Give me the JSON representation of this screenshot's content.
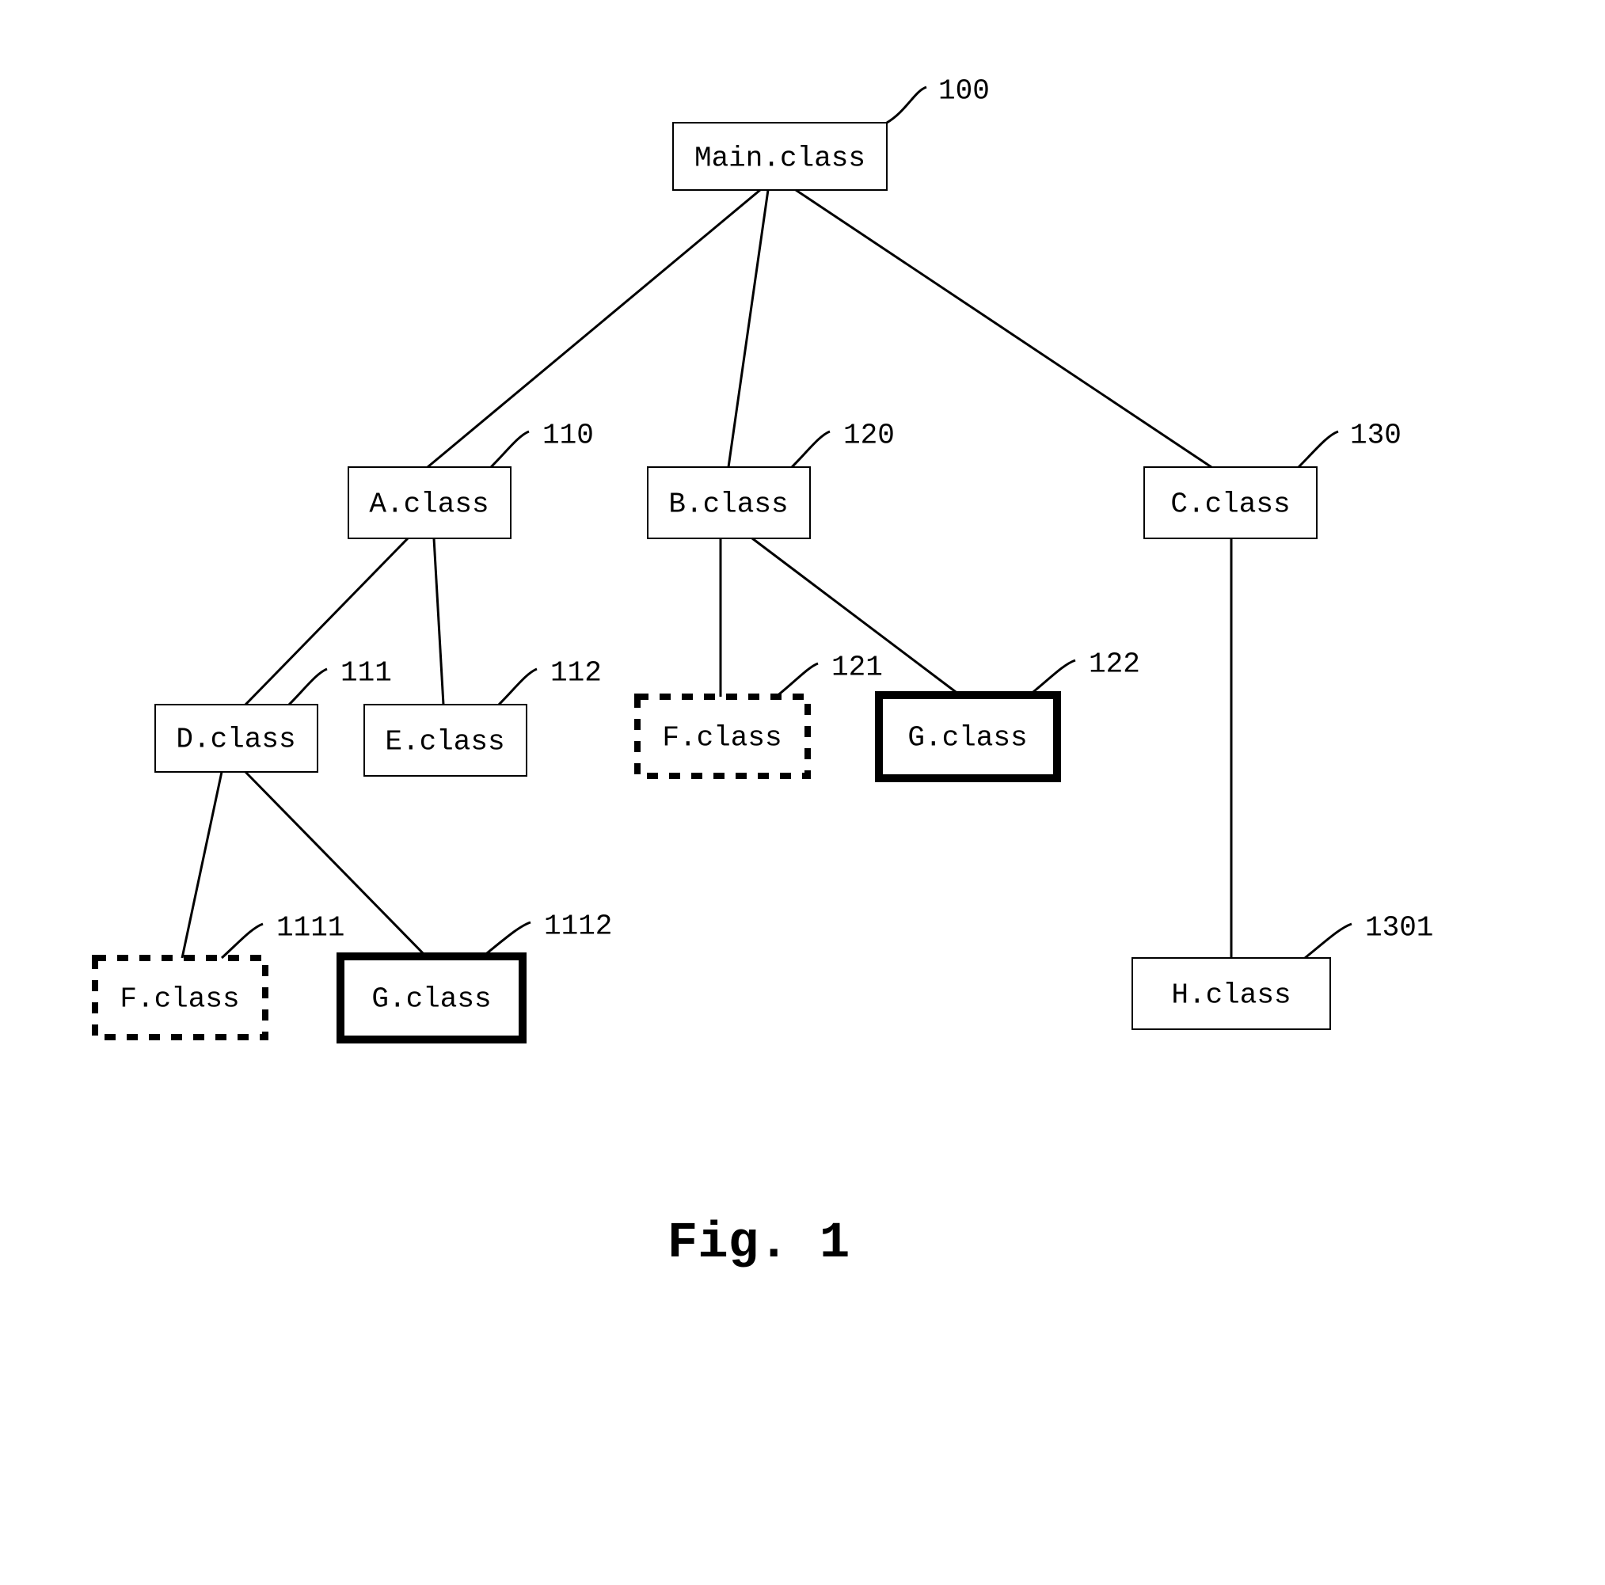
{
  "figure_label": "Fig. 1",
  "nodes": {
    "main": {
      "label": "Main.class",
      "ref": "100"
    },
    "a": {
      "label": "A.class",
      "ref": "110"
    },
    "b": {
      "label": "B.class",
      "ref": "120"
    },
    "c": {
      "label": "C.class",
      "ref": "130"
    },
    "d": {
      "label": "D.class",
      "ref": "111"
    },
    "e": {
      "label": "E.class",
      "ref": "112"
    },
    "f1": {
      "label": "F.class",
      "ref": "121"
    },
    "g1": {
      "label": "G.class",
      "ref": "122"
    },
    "f2": {
      "label": "F.class",
      "ref": "1111"
    },
    "g2": {
      "label": "G.class",
      "ref": "1112"
    },
    "h": {
      "label": "H.class",
      "ref": "1301"
    }
  },
  "chart_data": {
    "type": "tree",
    "title": "Fig. 1",
    "nodes": [
      {
        "id": "100",
        "label": "Main.class",
        "style": "thin"
      },
      {
        "id": "110",
        "label": "A.class",
        "style": "thin"
      },
      {
        "id": "120",
        "label": "B.class",
        "style": "thin"
      },
      {
        "id": "130",
        "label": "C.class",
        "style": "thin"
      },
      {
        "id": "111",
        "label": "D.class",
        "style": "thin"
      },
      {
        "id": "112",
        "label": "E.class",
        "style": "thin"
      },
      {
        "id": "121",
        "label": "F.class",
        "style": "dotted"
      },
      {
        "id": "122",
        "label": "G.class",
        "style": "thick"
      },
      {
        "id": "1111",
        "label": "F.class",
        "style": "dotted"
      },
      {
        "id": "1112",
        "label": "G.class",
        "style": "thick"
      },
      {
        "id": "1301",
        "label": "H.class",
        "style": "thin"
      }
    ],
    "edges": [
      {
        "from": "100",
        "to": "110"
      },
      {
        "from": "100",
        "to": "120"
      },
      {
        "from": "100",
        "to": "130"
      },
      {
        "from": "110",
        "to": "111"
      },
      {
        "from": "110",
        "to": "112"
      },
      {
        "from": "120",
        "to": "121"
      },
      {
        "from": "120",
        "to": "122"
      },
      {
        "from": "111",
        "to": "1111"
      },
      {
        "from": "111",
        "to": "1112"
      },
      {
        "from": "130",
        "to": "1301"
      }
    ]
  }
}
